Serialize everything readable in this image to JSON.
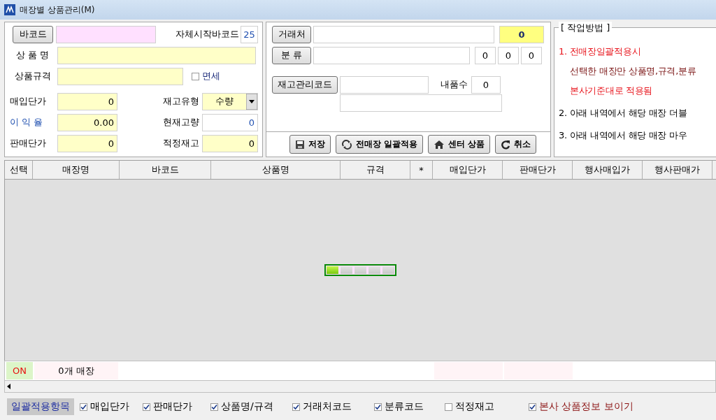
{
  "window": {
    "title": "매장별 상품관리(M)"
  },
  "product_form": {
    "barcode": {
      "button": "바코드"
    },
    "start_barcode": {
      "label": "자체시작바코드",
      "value": "25"
    },
    "product_name": {
      "label": "상 품 명"
    },
    "spec": {
      "label": "상품규격"
    },
    "tax_free": {
      "label": "면세",
      "checked": false
    },
    "purchase_price": {
      "label": "매입단가",
      "value": "0"
    },
    "stock_type": {
      "label": "재고유형",
      "value": "수량"
    },
    "margin_rate": {
      "label": "이 익 율",
      "value": "0.00"
    },
    "current_stock": {
      "label": "현재고량",
      "value": "0"
    },
    "sale_price": {
      "label": "판매단가",
      "value": "0"
    },
    "optimal_stock": {
      "label": "적정재고",
      "value": "0"
    }
  },
  "code_form": {
    "supplier": {
      "button": "거래처",
      "code": "0"
    },
    "category": {
      "button": "분 류",
      "codes": [
        "0",
        "0",
        "0"
      ]
    },
    "stock_code": {
      "button": "재고관리코드"
    },
    "inner_qty": {
      "label": "내품수",
      "value": "0"
    },
    "actions": [
      {
        "label": "저장",
        "kind": "save"
      },
      {
        "label": "전매장 일괄적용",
        "kind": "refresh"
      },
      {
        "label": "센터 상품",
        "kind": "home"
      },
      {
        "label": "취소",
        "kind": "undo"
      }
    ]
  },
  "instructions": {
    "title": "[ 작업방법 ]",
    "lines": [
      {
        "text": "1. 전매장일괄적용시",
        "kind": "alert"
      },
      {
        "text": "선택한 매장만 상품명,규격,분류",
        "kind": "detail"
      },
      {
        "text": "본사기준대로 적용됨",
        "kind": "alert-detail"
      },
      {
        "text": "2. 아래 내역에서 해당 매장 더블",
        "kind": "step"
      },
      {
        "text": "3. 아래 내역에서 해당 매장 마우",
        "kind": "step"
      }
    ]
  },
  "table": {
    "columns": [
      "선택",
      "매장명",
      "바코드",
      "상품명",
      "규격",
      "*",
      "매입단가",
      "판매단가",
      "행사매입가",
      "행사판매가"
    ],
    "summary": {
      "status": "ON",
      "store_count": "0개 매장"
    },
    "loading": {
      "level": 0.2
    }
  },
  "bulk_options": {
    "label": "일괄적용항목",
    "options": [
      {
        "label": "매입단가",
        "checked": true,
        "kind": "plain"
      },
      {
        "label": "판매단가",
        "checked": true,
        "kind": "plain"
      },
      {
        "label": "상품명/규격",
        "checked": true,
        "kind": "plain"
      },
      {
        "label": "거래처코드",
        "checked": true,
        "kind": "plain"
      },
      {
        "label": "분류코드",
        "checked": true,
        "kind": "plain"
      },
      {
        "label": "적정재고",
        "checked": false,
        "kind": "plain"
      },
      {
        "label": "본사 상품정보 보이기",
        "checked": true,
        "kind": "highlight"
      }
    ]
  }
}
